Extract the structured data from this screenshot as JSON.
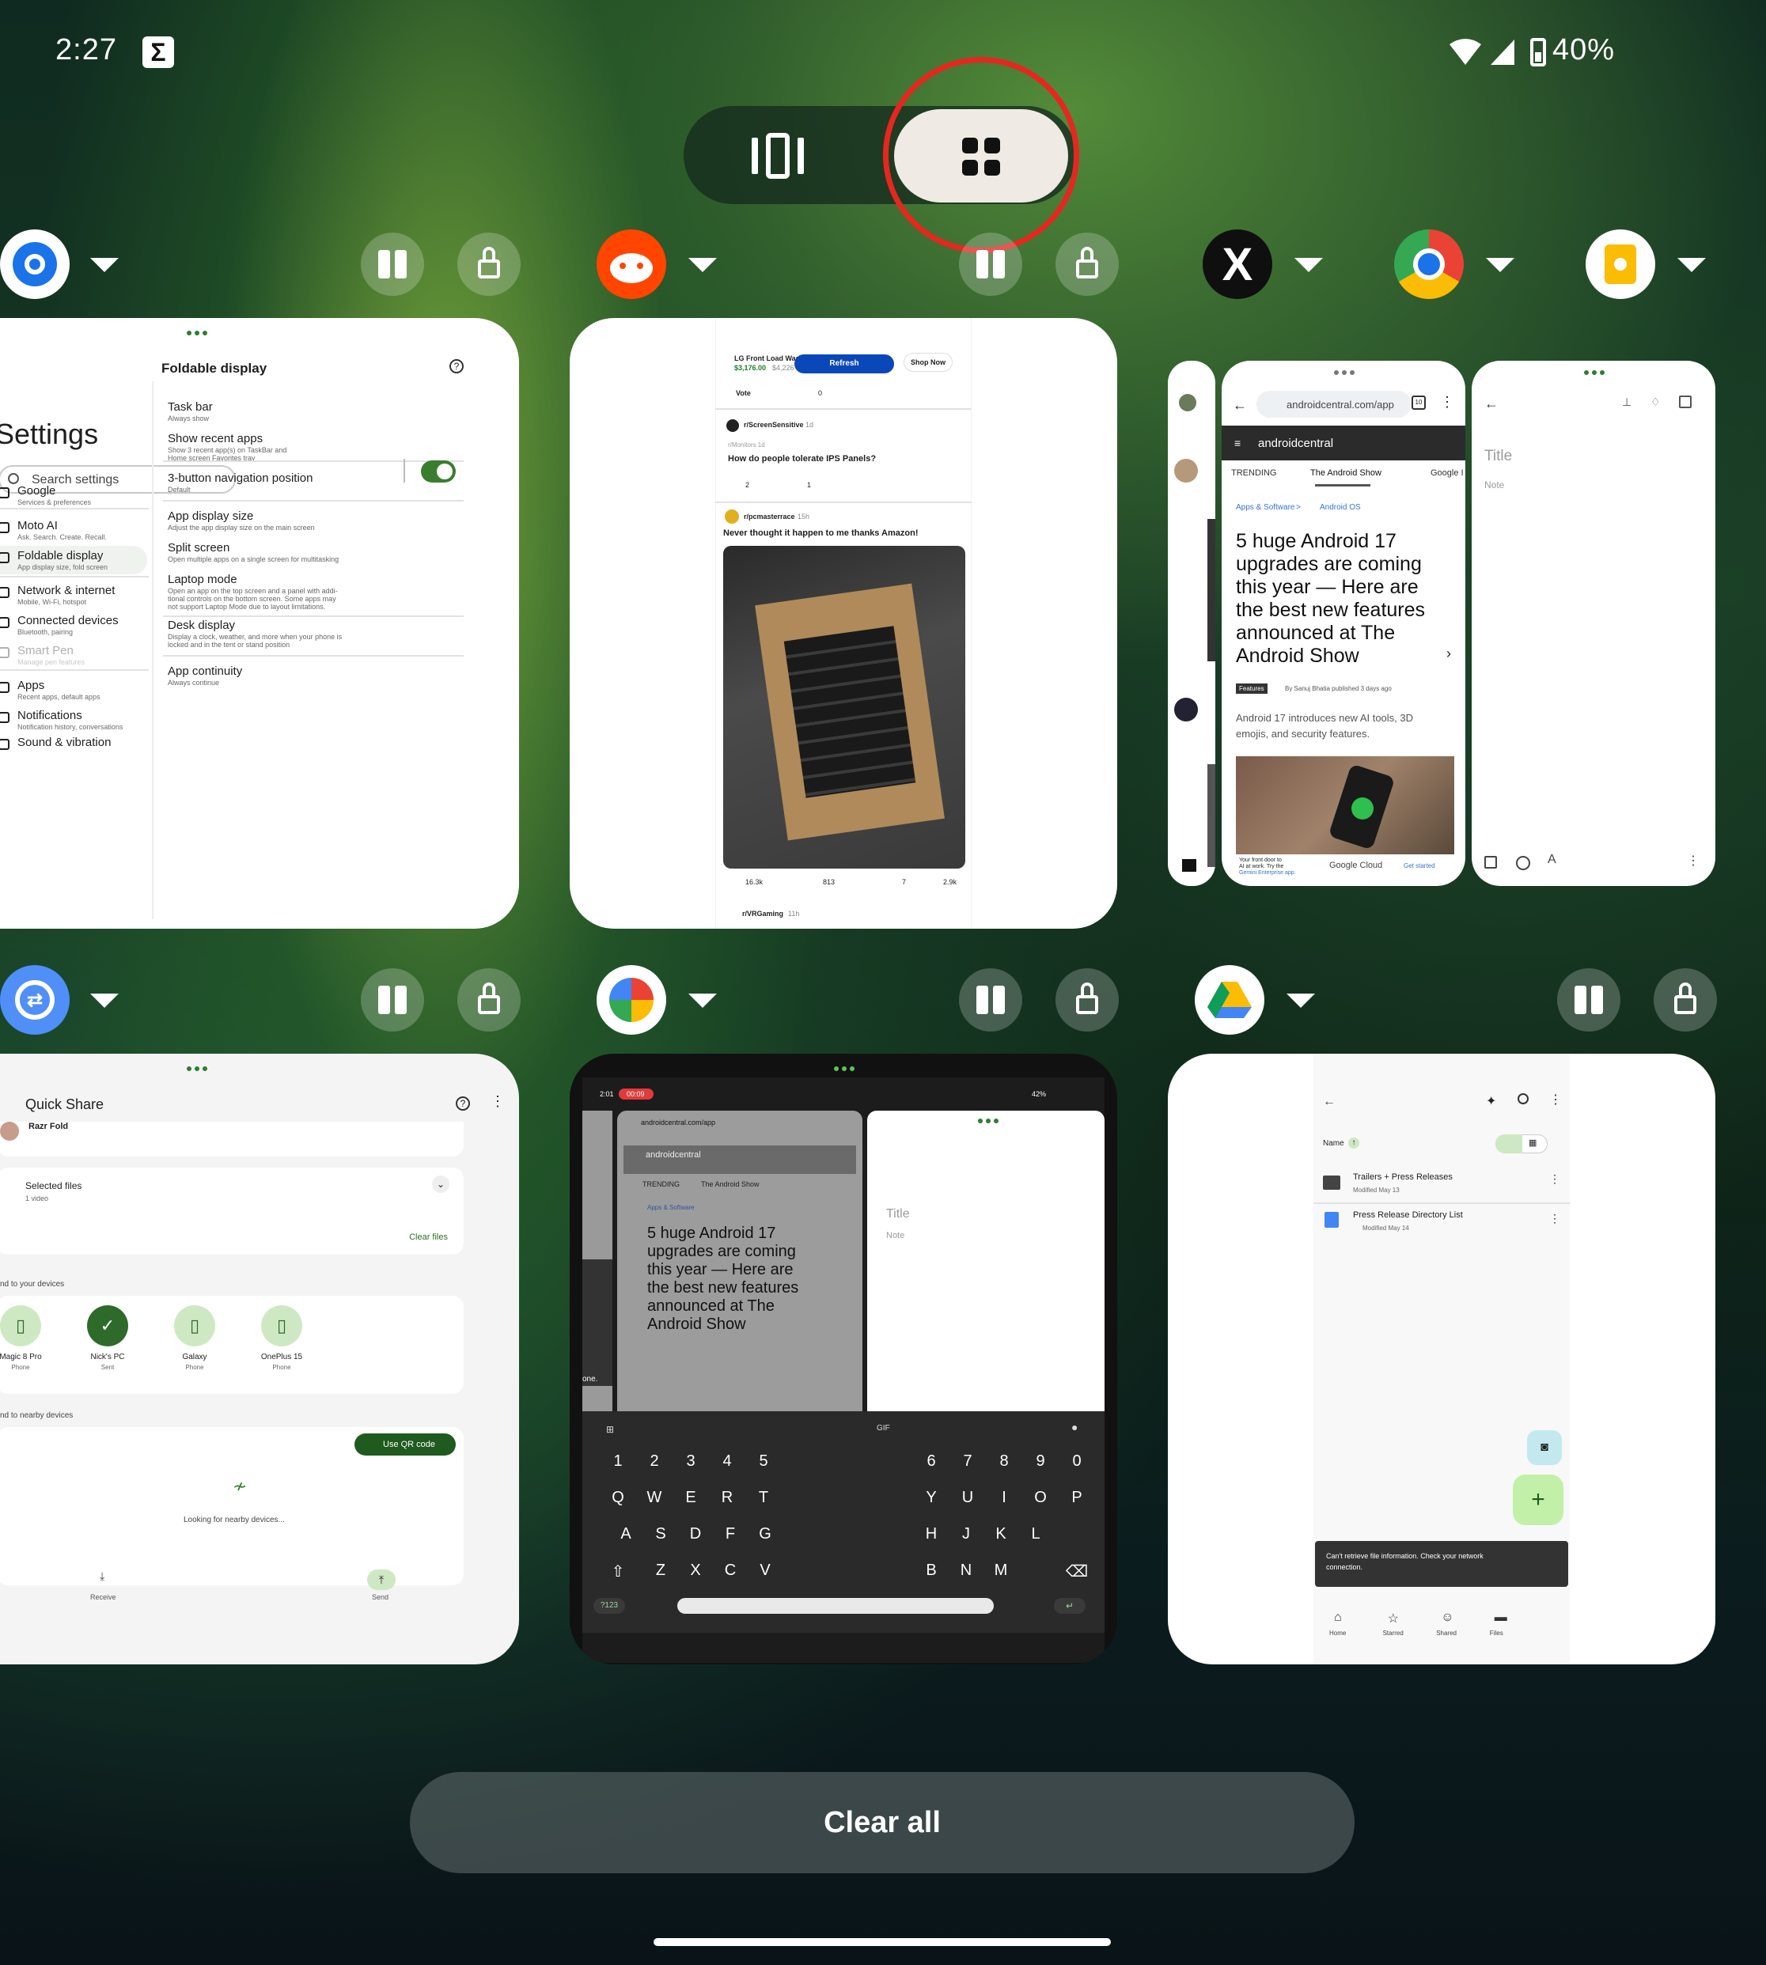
{
  "status_bar": {
    "time": "2:27",
    "battery": "40%",
    "notif_icon": "sigma-icon"
  },
  "view_toggle": {
    "carousel_icon": "carousel-view-icon",
    "grid_icon": "grid-view-icon",
    "highlight": "#e5271f"
  },
  "apps": {
    "settings": {
      "title": "Settings",
      "search_placeholder": "Search settings",
      "panel_title": "Foldable display",
      "items": [
        {
          "t": "Google",
          "s": "Services & preferences"
        },
        {
          "t": "Moto AI",
          "s": "Ask. Search. Create. Recall."
        },
        {
          "t": "Foldable display",
          "s": "App display size, fold screen"
        },
        {
          "t": "Network & internet",
          "s": "Mobile, Wi-Fi, hotspot"
        },
        {
          "t": "Connected devices",
          "s": "Bluetooth, pairing"
        },
        {
          "t": "Smart Pen",
          "s": "Manage pen features"
        },
        {
          "t": "Apps",
          "s": "Recent apps, default apps"
        },
        {
          "t": "Notifications",
          "s": "Notification history, conversations"
        },
        {
          "t": "Sound & vibration",
          "s": ""
        }
      ],
      "panel": [
        {
          "t": "Task bar",
          "s": "Always show"
        },
        {
          "t": "Show recent apps",
          "s": "Show 3 recent app(s) on TaskBar and",
          "s2": "Home screen Favorites tray"
        },
        {
          "t": "3-button navigation position",
          "s": "Default"
        },
        {
          "t": "App display size",
          "s": "Adjust the app display size on the main screen"
        },
        {
          "t": "Split screen",
          "s": "Open multiple apps on a single screen for multitasking"
        },
        {
          "t": "Laptop mode",
          "s": "Open an app on the top screen and a panel with addi-",
          "s2": "tional controls on the bottom screen. Some apps may",
          "s3": "not support Laptop Mode due to layout limitations."
        },
        {
          "t": "Desk display",
          "s": "Display a clock, weather, and more when your phone is",
          "s2": "locked and in the tent or stand position"
        },
        {
          "t": "App continuity",
          "s": "Always continue"
        }
      ]
    },
    "reddit": {
      "ad_title": "LG Front Load Was",
      "ad_price": "$3,176.00",
      "ad_old": "$4,226",
      "refresh": "Refresh",
      "shop_now": "Shop Now",
      "vote": "Vote",
      "zero": "0",
      "post1_sub": "r/ScreenSensitive",
      "post1_age": "1d",
      "post1_meta": "r/Monitors 1d",
      "post1_title": "How do people tolerate IPS Panels?",
      "post1_up": "2",
      "post1_c": "1",
      "post2_sub": "r/pcmasterrace",
      "post2_age": "15h",
      "post2_title": "Never thought it happen to me thanks Amazon!",
      "post2_up": "16.3k",
      "post2_c": "813",
      "post2_award": "7",
      "post2_share": "2.9k",
      "post3_sub": "r/VRGaming",
      "post3_age": "11h"
    },
    "chrome": {
      "url": "androidcentral.com/app",
      "tabs_count": "10",
      "brand": "androidcentral",
      "nav": [
        "TRENDING",
        "The Android Show",
        "Google I"
      ],
      "crumb1": "Apps & Software",
      "crumb_sep": ">",
      "crumb2": "Android OS",
      "headline": [
        "5 huge Android 17",
        "upgrades are coming",
        "this year — Here are",
        "the best new features",
        "announced at The",
        "Android Show"
      ],
      "tag": "Features",
      "byline": "By Sanuj Bhatia published 3 days ago",
      "summary": [
        "Android 17 introduces new AI tools, 3D",
        "emojis, and security features."
      ],
      "ad1": "Your front door to",
      "ad2": "AI at work. Try the",
      "ad3": "Gemini Enterprise app.",
      "ad_brand": "Google Cloud",
      "ad_cta": "Get started"
    },
    "keep": {
      "title_ph": "Title",
      "note_ph": "Note"
    },
    "quickshare": {
      "title": "Quick Share",
      "device_top": "Razr Fold",
      "selected": "Selected files",
      "count": "1 video",
      "clear": "Clear files",
      "your_devices": "nd to your devices",
      "nearby": "nd to nearby devices",
      "qr": "Use QR code",
      "looking": "Looking for nearby devices...",
      "receive": "Receive",
      "send": "Send",
      "devices": [
        {
          "n": "Magic 8 Pro",
          "s": "Phone"
        },
        {
          "n": "Nick's PC",
          "s": "Sent"
        },
        {
          "n": "Galaxy",
          "s": "Phone"
        },
        {
          "n": "OnePlus 15",
          "s": "Phone"
        }
      ]
    },
    "photos": {
      "time": "2:01",
      "rec": "00:09",
      "battery": "42%",
      "key_rows": [
        [
          "1",
          "2",
          "3",
          "4",
          "5"
        ],
        [
          "Q",
          "W",
          "E",
          "R",
          "T"
        ],
        [
          "A",
          "S",
          "D",
          "F",
          "G"
        ],
        [
          "Z",
          "X",
          "C",
          "V"
        ]
      ],
      "key_rows_r": [
        [
          "6",
          "7",
          "8",
          "9",
          "0"
        ],
        [
          "Y",
          "U",
          "I",
          "O",
          "P"
        ],
        [
          "H",
          "J",
          "K",
          "L"
        ],
        [
          "B",
          "N",
          "M"
        ]
      ],
      "sym": "?123",
      "gif": "GIF",
      "hint": "one."
    },
    "drive": {
      "sort": "Name",
      "file1": "Trailers + Press Releases",
      "file1_meta": "Modified May 13",
      "file2": "Press Release Directory List",
      "file2_meta": "Modified May 14",
      "snackbar": [
        "Can't retrieve file information. Check your network",
        "connection."
      ],
      "nav": [
        "Home",
        "Starred",
        "Shared",
        "Files"
      ]
    }
  },
  "clear_all": "Clear all"
}
